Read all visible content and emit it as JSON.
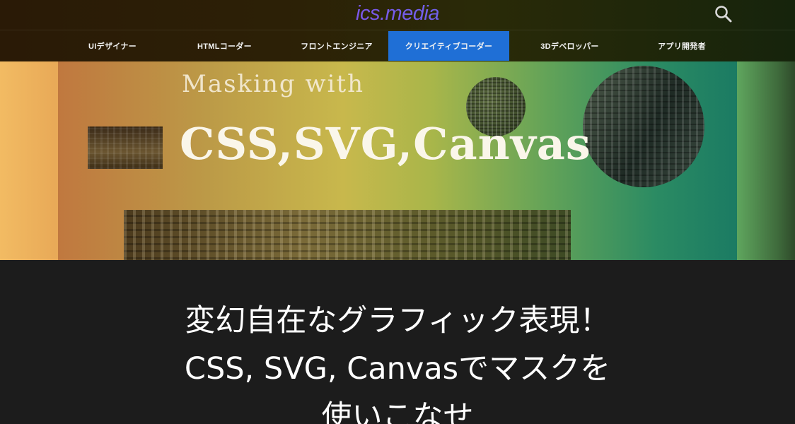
{
  "header": {
    "logo": "ics.media",
    "search_icon": "search-icon",
    "nav": [
      {
        "label": "UIデザイナー",
        "active": false
      },
      {
        "label": "HTMLコーダー",
        "active": false
      },
      {
        "label": "フロントエンジニア",
        "active": false
      },
      {
        "label": "クリエイティブコーダー",
        "active": true
      },
      {
        "label": "3Dデベロッパー",
        "active": false
      },
      {
        "label": "アプリ開発者",
        "active": false
      }
    ],
    "active_color": "#1f6fd6"
  },
  "hero": {
    "line1": "Masking with",
    "line2": "CSS,SVG,Canvas"
  },
  "article": {
    "title_line1": "変幻自在なグラフィック表現！",
    "title_line2": "CSS, SVG, Canvasでマスクを",
    "title_line3": "使いこなせ"
  }
}
